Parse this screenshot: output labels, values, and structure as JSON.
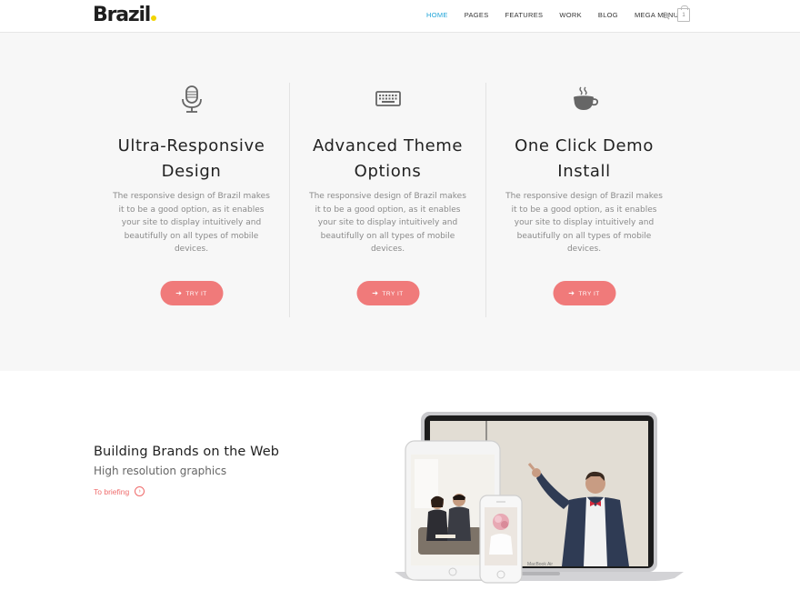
{
  "header": {
    "logo_text": "Brazil",
    "logo_dot_color": "#f2d400",
    "nav": [
      "HOME",
      "PAGES",
      "FEATURES",
      "WORK",
      "BLOG",
      "MEGA MENU"
    ],
    "active_nav": "HOME",
    "cart_count": "1",
    "accent_color": "#1ea4d8"
  },
  "features": [
    {
      "icon": "microphone-icon",
      "title": "Ultra-Responsive Design",
      "text": "The responsive design of Brazil makes it to be a good option, as it enables your site to display intuitively and beautifully on all types of mobile devices.",
      "button": "TRY IT"
    },
    {
      "icon": "keyboard-icon",
      "title": "Advanced Theme Options",
      "text": "The responsive design of Brazil makes it to be a good option, as it enables your site to display intuitively and beautifully on all types of mobile devices.",
      "button": "TRY IT"
    },
    {
      "icon": "coffee-cup-icon",
      "title": "One Click Demo Install",
      "text": "The responsive design of Brazil makes it to be a good option, as it enables your site to display intuitively and beautifully on all types of mobile devices.",
      "button": "TRY IT"
    }
  ],
  "button_color": "#f07a7a",
  "brand": {
    "title": "Building Brands on the Web",
    "subtitle": "High resolution graphics",
    "link": "To briefing",
    "link_color": "#ef6b6b"
  },
  "devices": {
    "laptop_label": "MacBook Air"
  }
}
